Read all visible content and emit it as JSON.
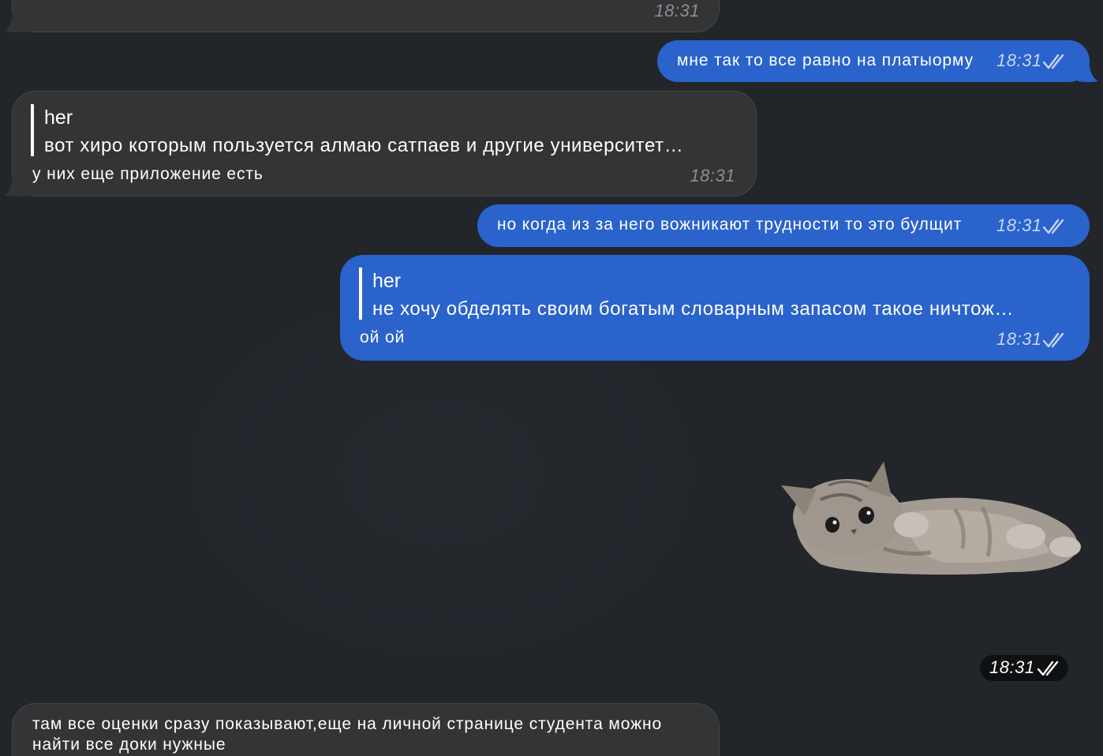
{
  "messages": [
    {
      "id": "m0",
      "direction": "incoming",
      "time": "18:31"
    },
    {
      "id": "m1",
      "direction": "outgoing",
      "text": "мне так то все равно на платыорму",
      "time": "18:31"
    },
    {
      "id": "m2",
      "direction": "incoming",
      "reply_author": "her",
      "reply_text": "вот хиро которым пользуется алмаю сатпаев и другие университет…",
      "text": "у них еще приложение есть",
      "time": "18:31"
    },
    {
      "id": "m3",
      "direction": "outgoing",
      "text": "но когда из за него вожникают трудности то это булщит",
      "time": "18:31"
    },
    {
      "id": "m4",
      "direction": "outgoing",
      "reply_author": "her",
      "reply_text": "не хочу обделять своим богатым словарным запасом такое ничтож…",
      "text": "ой ой",
      "time": "18:31"
    },
    {
      "id": "m5",
      "direction": "outgoing",
      "type": "sticker",
      "sticker": "kitten-lying-on-back",
      "time": "18:31"
    },
    {
      "id": "m6",
      "direction": "incoming",
      "text": "там все оценки сразу показывают,еще на личной странице студента можно найти все доки нужные"
    }
  ],
  "colors": {
    "background": "#22252a",
    "incoming_bubble": "#333436",
    "outgoing_bubble": "#2b63cc",
    "sticker_time_pill": "#0f1012"
  },
  "icons": {
    "read_receipt": "double-check-icon"
  }
}
